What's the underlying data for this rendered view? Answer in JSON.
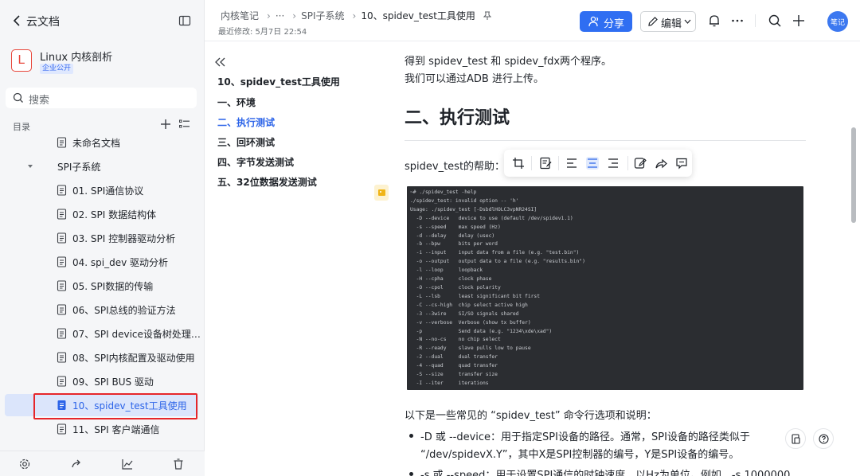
{
  "sidebar": {
    "title": "云文档",
    "workspace": {
      "logo_letter": "L",
      "name": "Linux 内核剖析",
      "badge": "企业公开"
    },
    "search_placeholder": "搜索",
    "toc_label": "目录",
    "items": [
      {
        "label": "未命名文档",
        "level": 2,
        "type": "doc"
      },
      {
        "label": "SPI子系统",
        "level": 1,
        "type": "folder"
      },
      {
        "label": "01. SPI通信协议",
        "level": 2,
        "type": "doc"
      },
      {
        "label": "02. SPI 数据结构体",
        "level": 2,
        "type": "doc"
      },
      {
        "label": "03. SPI 控制器驱动分析",
        "level": 2,
        "type": "doc"
      },
      {
        "label": "04. spi_dev 驱动分析",
        "level": 2,
        "type": "doc"
      },
      {
        "label": "05. SPI数据的传输",
        "level": 2,
        "type": "doc"
      },
      {
        "label": "06、SPI总线的验证方法",
        "level": 2,
        "type": "doc"
      },
      {
        "label": "07、SPI device设备树处理…",
        "level": 2,
        "type": "doc"
      },
      {
        "label": "08、SPI内核配置及驱动使用",
        "level": 2,
        "type": "doc"
      },
      {
        "label": "09、SPI BUS 驱动",
        "level": 2,
        "type": "doc"
      },
      {
        "label": "10、spidev_test工具使用",
        "level": 2,
        "type": "doc",
        "active": true
      },
      {
        "label": "11、SPI 客户端通信",
        "level": 2,
        "type": "doc"
      }
    ]
  },
  "header": {
    "breadcrumbs": [
      "内核笔记",
      "···",
      "SPI子系统",
      "10、spidev_test工具使用"
    ],
    "modified": "最近修改: 5月7日 22:54",
    "share_label": "分享",
    "edit_label": "编辑",
    "avatar_text": "笔记"
  },
  "outline": {
    "title": "10、spidev_test工具使用",
    "items": [
      {
        "label": "一、环境"
      },
      {
        "label": "二、执行测试",
        "active": true
      },
      {
        "label": "三、回环测试"
      },
      {
        "label": "四、字节发送测试"
      },
      {
        "label": "五、32位数据发送测试"
      }
    ]
  },
  "content": {
    "line1": "得到 spidev_test 和 spidev_fdx两个程序。",
    "line2": "我们可以通过ADB 进行上传。",
    "heading": "二、执行测试",
    "help_label": "spidev_test的帮助：",
    "terminal_lines": [
      "~# ./spidev_test -help",
      "./spidev_test: invalid option -- 'h'",
      "Usage: ./spidev_test [-DsbdlHOLC3vpNR24SI]",
      "  -D --device   device to use (default /dev/spidev1.1)",
      "  -s --speed    max speed (Hz)",
      "  -d --delay    delay (usec)",
      "  -b --bpw      bits per word",
      "  -i --input    input data from a file (e.g. \"test.bin\")",
      "  -o --output   output data to a file (e.g. \"results.bin\")",
      "  -l --loop     loopback",
      "  -H --cpha     clock phase",
      "  -O --cpol     clock polarity",
      "  -L --lsb      least significant bit first",
      "  -C --cs-high  chip select active high",
      "  -3 --3wire    SI/SO signals shared",
      "  -v --verbose  Verbose (show tx buffer)",
      "  -p            Send data (e.g. \"1234\\xde\\xad\")",
      "  -N --no-cs    no chip select",
      "  -R --ready    slave pulls low to pause",
      "  -2 --dual     dual transfer",
      "  -4 --quad     quad transfer",
      "  -S --size     transfer size",
      "  -I --iter     iterations"
    ],
    "intro": "以下是一些常见的 “spidev_test” 命令行选项和说明：",
    "bullet1_line1": "-D 或 --device：用于指定SPI设备的路径。通常，SPI设备的路径类似于",
    "bullet1_line2": "“/dev/spidevX.Y”，其中X是SPI控制器的编号，Y是SPI设备的编号。",
    "bullet2_line1": "-s 或 --speed：用于设置SPI通信的时钟速度，以Hz为单位。例如，-s 1000000"
  }
}
